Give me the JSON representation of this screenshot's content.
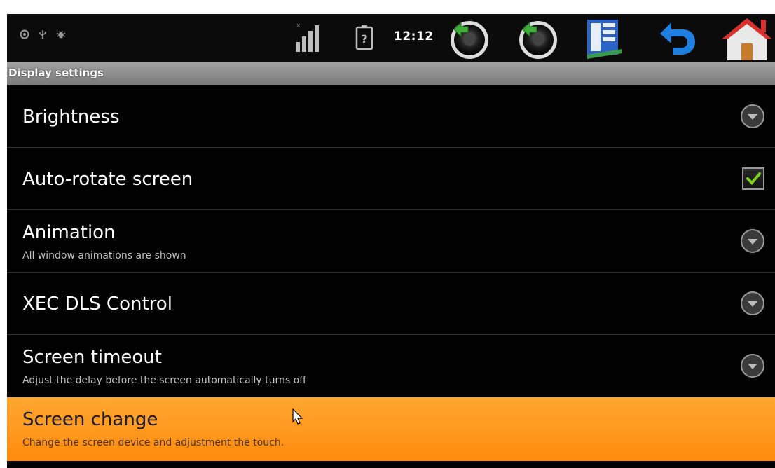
{
  "status_bar": {
    "time": "12:12",
    "icons": [
      "settings-icon",
      "usb-icon",
      "debug-bug-icon",
      "signal-icon",
      "battery-unknown-icon",
      "volume-down-icon",
      "volume-up-icon",
      "menu-icon",
      "back-icon",
      "home-icon"
    ]
  },
  "header": {
    "title": "Display settings"
  },
  "settings": {
    "items": [
      {
        "title": "Brightness",
        "summary": "",
        "widget": "dropdown"
      },
      {
        "title": "Auto-rotate screen",
        "summary": "",
        "widget": "checkbox",
        "checked": true
      },
      {
        "title": "Animation",
        "summary": "All window animations are shown",
        "widget": "dropdown"
      },
      {
        "title": "XEC DLS Control",
        "summary": "",
        "widget": "dropdown"
      },
      {
        "title": "Screen timeout",
        "summary": "Adjust the delay before the screen automatically turns off",
        "widget": "dropdown"
      },
      {
        "title": "Screen change",
        "summary": "Change the screen device and adjustment the touch.",
        "widget": "none",
        "selected": true
      }
    ]
  },
  "colors": {
    "selected_row": "#ff9a1f",
    "check_mark": "#7ed321",
    "background": "#000000",
    "title_bar": "#8c8c8c"
  }
}
